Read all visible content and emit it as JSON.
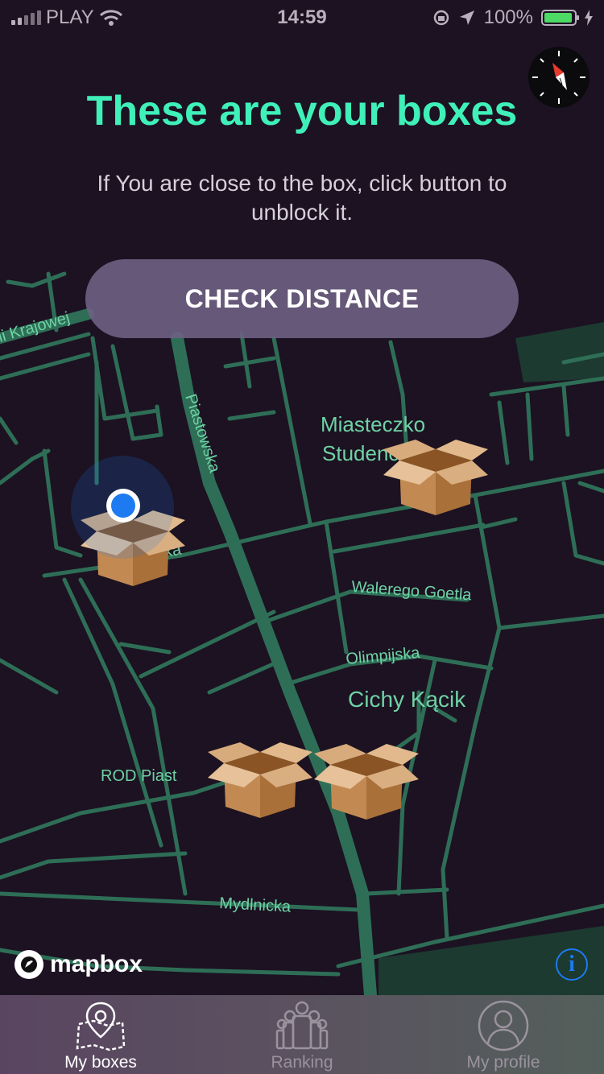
{
  "status_bar": {
    "carrier": "PLAY",
    "time": "14:59",
    "battery": "100%"
  },
  "header": {
    "title": "These are your boxes",
    "subtitle": "If You are close to the box, click button to unblock it."
  },
  "actions": {
    "check_distance": "CHECK DISTANCE"
  },
  "map": {
    "labels": {
      "krajowej": "ii Krajowej",
      "piastowska": "Piastowska",
      "miasteczko_1": "Miasteczko",
      "miasteczko_2": "Studenc",
      "walerego": "Walerego Goetla",
      "olimpijska": "Olimpijska",
      "cichy": "Cichy Kącik",
      "rod": "ROD Piast",
      "mydlnicka": "Mydlnicka",
      "ka": "ka"
    },
    "attribution": "mapbox",
    "info_glyph": "i",
    "colors": {
      "background": "#1c1222",
      "road": "#2e6e56",
      "road_label": "#6fd2a4"
    }
  },
  "tabs": [
    {
      "label": "My boxes",
      "icon": "map-pin-icon",
      "active": true
    },
    {
      "label": "Ranking",
      "icon": "group-icon",
      "active": false
    },
    {
      "label": "My profile",
      "icon": "profile-icon",
      "active": false
    }
  ],
  "accent": "#3ff0b8",
  "location_color": "#1e7af0"
}
